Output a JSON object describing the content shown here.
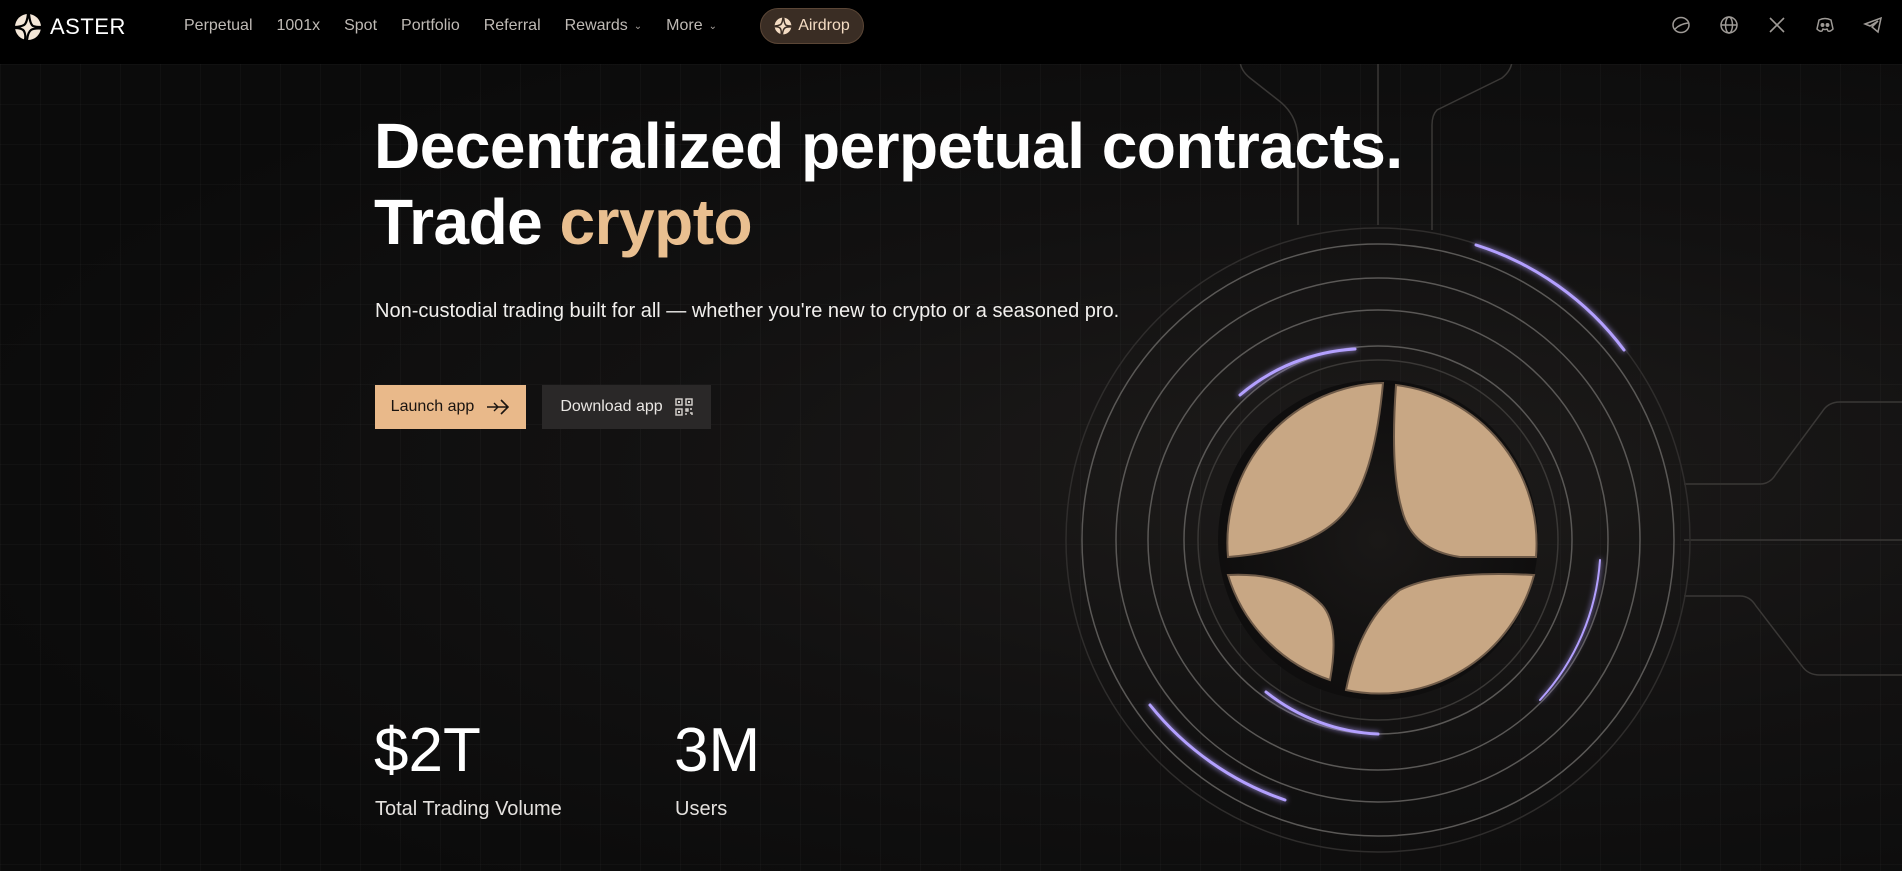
{
  "brand": {
    "name": "ASTER"
  },
  "nav": {
    "items": [
      {
        "label": "Perpetual",
        "has_dropdown": false
      },
      {
        "label": "1001x",
        "has_dropdown": false
      },
      {
        "label": "Spot",
        "has_dropdown": false
      },
      {
        "label": "Portfolio",
        "has_dropdown": false
      },
      {
        "label": "Referral",
        "has_dropdown": false
      },
      {
        "label": "Rewards",
        "has_dropdown": true
      },
      {
        "label": "More",
        "has_dropdown": true
      }
    ],
    "airdrop_label": "Airdrop",
    "social_icons": [
      "chat-bubble-icon",
      "globe-icon",
      "x-icon",
      "discord-icon",
      "telegram-icon"
    ]
  },
  "hero": {
    "title_line1": "Decentralized perpetual contracts.",
    "title_line2_prefix": "Trade",
    "title_line2_accent": "crypto",
    "subtitle": "Non-custodial trading built for all — whether you're new to crypto or a seasoned pro.",
    "launch_label": "Launch app",
    "download_label": "Download app"
  },
  "stats": [
    {
      "value": "$2T",
      "label": "Total Trading Volume"
    },
    {
      "value": "3M",
      "label": "Users"
    }
  ],
  "colors": {
    "accent": "#e9bf90",
    "button_primary": "#e9b98a",
    "button_secondary": "#2a2828",
    "glow": "#b3a0ff",
    "background": "#0b0b0b"
  }
}
